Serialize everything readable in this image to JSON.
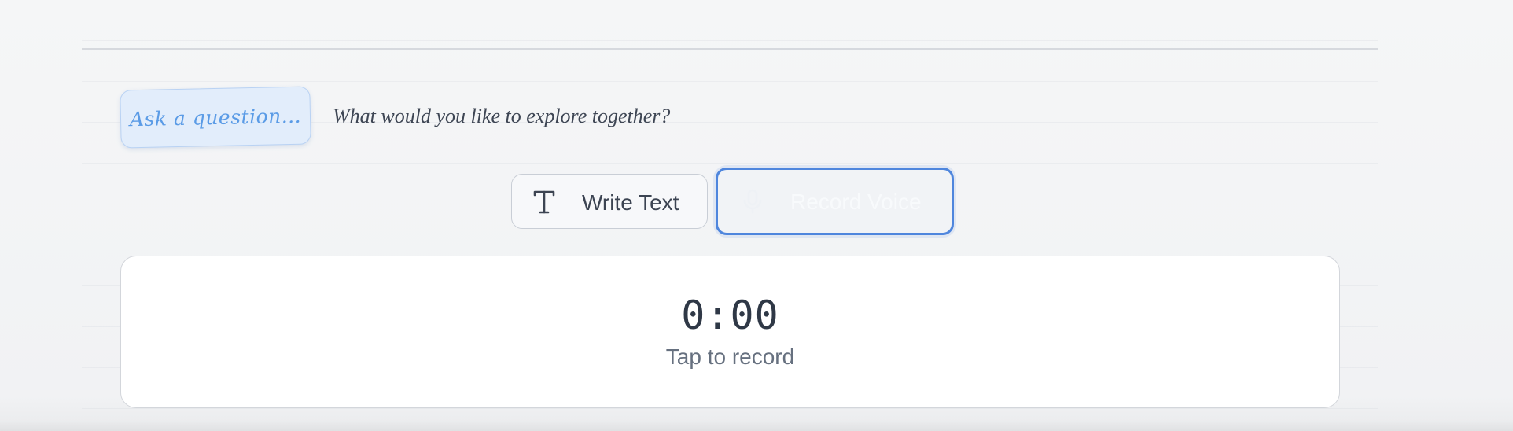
{
  "prompt": {
    "sticker_label": "Ask a question...",
    "subtitle": "What would you like to explore together?"
  },
  "mode_buttons": {
    "write": {
      "label": "Write Text",
      "icon": "text-icon"
    },
    "record": {
      "label": "Record Voice",
      "icon": "microphone-icon",
      "selected": true
    }
  },
  "recorder": {
    "timer": "0:00",
    "hint": "Tap to record"
  },
  "colors": {
    "accent": "#4f86dd",
    "sticker_bg": "#e2edfb",
    "sticker_text": "#5a9be6",
    "text_dark": "#3c4452",
    "text_muted": "#66707f"
  }
}
